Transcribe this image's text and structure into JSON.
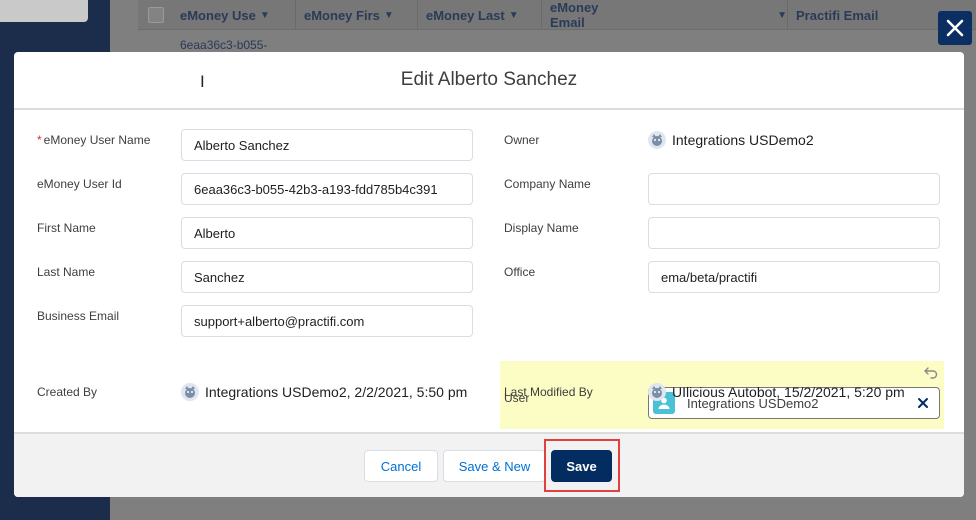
{
  "background": {
    "columns": [
      "eMoney Use",
      "eMoney Firs",
      "eMoney Last",
      "eMoney Email",
      "Practifi Email"
    ],
    "cell_value": "6eaa36c3-b055-"
  },
  "modal": {
    "title": "Edit Alberto Sanchez",
    "left_fields": [
      {
        "label": "eMoney User Name",
        "value": "Alberto Sanchez",
        "required": true
      },
      {
        "label": "eMoney User Id",
        "value": "6eaa36c3-b055-42b3-a193-fdd785b4c391"
      },
      {
        "label": "First Name",
        "value": "Alberto"
      },
      {
        "label": "Last Name",
        "value": "Sanchez"
      },
      {
        "label": "Business Email",
        "value": "support+alberto@practifi.com"
      }
    ],
    "created_by": {
      "label": "Created By",
      "value": "Integrations USDemo2, 2/2/2021, 5:50 pm"
    },
    "right_fields": {
      "owner": {
        "label": "Owner",
        "value": "Integrations USDemo2"
      },
      "company_name": {
        "label": "Company Name",
        "value": ""
      },
      "display_name": {
        "label": "Display Name",
        "value": ""
      },
      "office": {
        "label": "Office",
        "value": "ema/beta/practifi"
      },
      "user": {
        "label": "User",
        "value": "Integrations USDemo2"
      },
      "last_modified_by": {
        "label": "Last Modified By",
        "value": "UIlicious Autobot, 15/2/2021, 5:20 pm"
      }
    },
    "required_marker": "*"
  },
  "footer": {
    "cancel_label": "Cancel",
    "save_new_label": "Save & New",
    "save_label": "Save"
  },
  "colors": {
    "brand": "#032d60",
    "link": "#0070d2",
    "highlight": "#fcfdc4",
    "required": "#c23934",
    "annotation": "#e0403e",
    "user_icon": "#4bc1d6"
  }
}
